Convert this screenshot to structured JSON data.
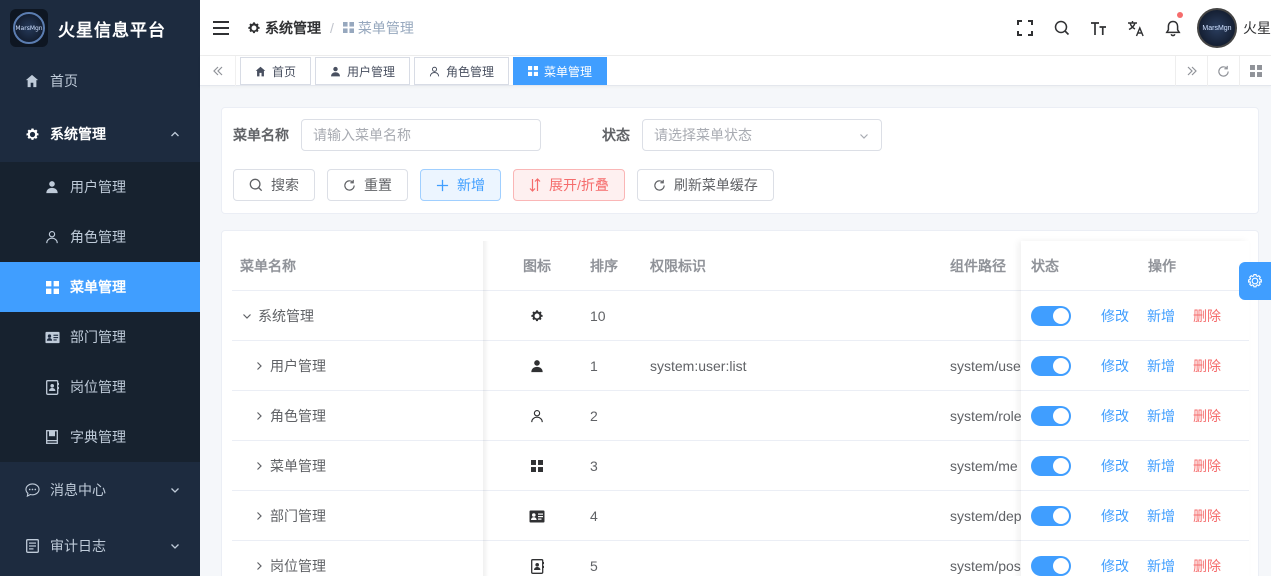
{
  "app": {
    "title": "火星信息平台",
    "logo_text": "MarsMgn",
    "user_name": "火星"
  },
  "sidebar": {
    "items": [
      {
        "label": "首页",
        "icon": "home-icon"
      },
      {
        "label": "系统管理",
        "icon": "gear-icon",
        "expanded": true
      },
      {
        "label": "消息中心",
        "icon": "chat-icon"
      },
      {
        "label": "审计日志",
        "icon": "log-icon"
      }
    ],
    "system_children": [
      {
        "label": "用户管理",
        "icon": "user-icon"
      },
      {
        "label": "角色管理",
        "icon": "user-outline-icon"
      },
      {
        "label": "菜单管理",
        "icon": "grid-icon",
        "active": true
      },
      {
        "label": "部门管理",
        "icon": "id-card-icon"
      },
      {
        "label": "岗位管理",
        "icon": "contact-book-icon"
      },
      {
        "label": "字典管理",
        "icon": "book-icon"
      }
    ]
  },
  "header": {
    "breadcrumb": [
      {
        "label": "系统管理"
      },
      {
        "label": "菜单管理"
      }
    ],
    "tools": [
      "fullscreen-icon",
      "search-icon",
      "font-size-icon",
      "translate-icon",
      "bell-icon"
    ]
  },
  "tags": [
    {
      "label": "首页",
      "icon": "home-icon"
    },
    {
      "label": "用户管理",
      "icon": "user-icon"
    },
    {
      "label": "角色管理",
      "icon": "user-outline-icon"
    },
    {
      "label": "菜单管理",
      "icon": "grid-icon",
      "active": true
    }
  ],
  "search": {
    "name_label": "菜单名称",
    "name_placeholder": "请输入菜单名称",
    "status_label": "状态",
    "status_placeholder": "请选择菜单状态"
  },
  "buttons": {
    "search": "搜索",
    "reset": "重置",
    "add": "新增",
    "toggle_expand": "展开/折叠",
    "refresh_cache": "刷新菜单缓存"
  },
  "table": {
    "headers": {
      "name": "菜单名称",
      "icon": "图标",
      "sort": "排序",
      "perm": "权限标识",
      "path": "组件路径",
      "status": "状态",
      "ops": "操作"
    },
    "op_labels": {
      "edit": "修改",
      "add": "新增",
      "delete": "删除"
    },
    "rows": [
      {
        "name": "系统管理",
        "icon": "gear-icon",
        "sort": "10",
        "perm": "",
        "path": "",
        "level": 0,
        "expanded": true,
        "enabled": true
      },
      {
        "name": "用户管理",
        "icon": "user-icon",
        "sort": "1",
        "perm": "system:user:list",
        "path": "system/use",
        "level": 1,
        "expanded": false,
        "enabled": true
      },
      {
        "name": "角色管理",
        "icon": "user-outline-icon",
        "sort": "2",
        "perm": "",
        "path": "system/role",
        "level": 1,
        "expanded": false,
        "enabled": true
      },
      {
        "name": "菜单管理",
        "icon": "grid-icon",
        "sort": "3",
        "perm": "",
        "path": "system/me",
        "level": 1,
        "expanded": false,
        "enabled": true
      },
      {
        "name": "部门管理",
        "icon": "id-card-icon",
        "sort": "4",
        "perm": "",
        "path": "system/dep",
        "level": 1,
        "expanded": false,
        "enabled": true
      },
      {
        "name": "岗位管理",
        "icon": "contact-book-icon",
        "sort": "5",
        "perm": "",
        "path": "system/pos",
        "level": 1,
        "expanded": false,
        "enabled": true
      }
    ]
  },
  "colors": {
    "primary": "#409eff",
    "danger": "#f56c6c",
    "sidebar_bg": "#1d2b3f",
    "submenu_bg": "#17222f"
  }
}
